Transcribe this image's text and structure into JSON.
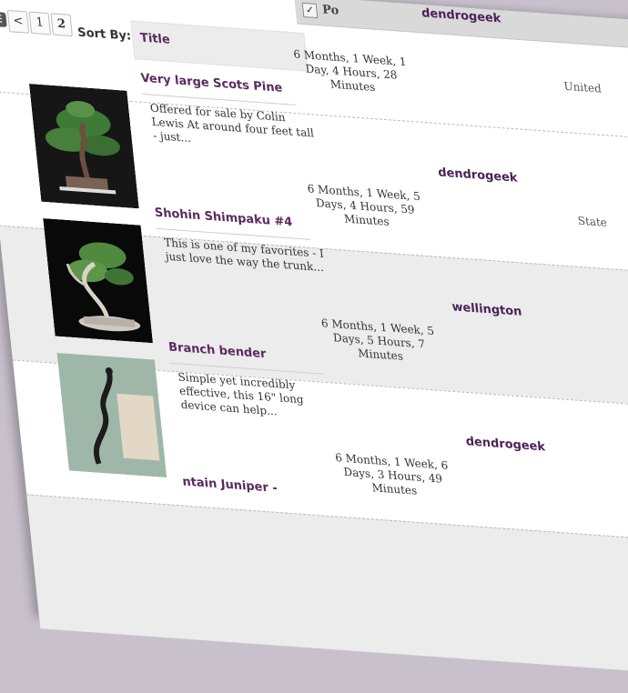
{
  "pagination": {
    "prev": "<",
    "pages": [
      "1",
      "2"
    ],
    "current": "2"
  },
  "table_header": {
    "post_label": "Po"
  },
  "sort": {
    "label": "Sort By:",
    "value": "Title"
  },
  "top_user": "dendrogeek",
  "listings": [
    {
      "title": "Very large Scots Pine",
      "description": "Offered for sale by Colin Lewis At around four feet tall - just...",
      "time": "6 Months, 1 Week, 1 Day, 4 Hours, 28 Minutes",
      "user": "dendrogeek",
      "location": "United"
    },
    {
      "title": "Shohin Shimpaku #4",
      "description": "This is one of my favorites - I just love the way the trunk...",
      "time": "6 Months, 1 Week, 5 Days, 4 Hours, 59 Minutes",
      "user": "wellington",
      "location": "State"
    },
    {
      "title": "Branch bender",
      "description": "Simple yet incredibly effective, this 16\" long device can help...",
      "time": "6 Months, 1 Week, 5 Days, 5 Hours, 7 Minutes",
      "user": "dendrogeek",
      "location": ""
    },
    {
      "title": "ntain Juniper -",
      "description": "",
      "time": "6 Months, 1 Week, 6 Days, 3 Hours, 49 Minutes",
      "user": "",
      "location": ""
    }
  ]
}
